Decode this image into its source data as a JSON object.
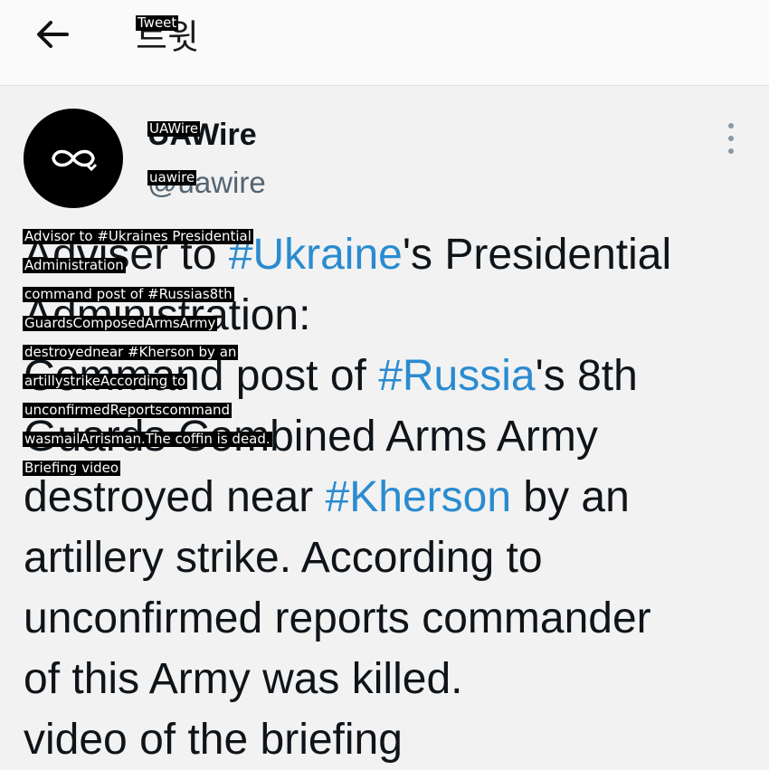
{
  "header": {
    "title": "트윗",
    "title_overlay": "Tweet"
  },
  "tweet": {
    "display_name": "UAWire",
    "display_name_overlay": "UAWire",
    "handle": "@uawire",
    "handle_overlay": "uawire",
    "avatar_icon": "infinity-logo-icon",
    "body": {
      "l1_pre": "Adviser to ",
      "l1_tag": "#Ukraine",
      "l1_post": "'s Presidential",
      "l2": "Administration:",
      "l3_pre": "Command post of ",
      "l3_tag": "#Russia",
      "l3_post": "'s 8th",
      "l4": "Guards Combined Arms Army",
      "l5_pre": "destroyed near ",
      "l5_tag": "#Kherson",
      "l5_post": " by an",
      "l6": "artillery strike. According to",
      "l7": "unconfirmed reports commander",
      "l8": "of this Army was killed.",
      "l9": "video of the briefing"
    },
    "overlay_lines": [
      "Advisor to #Ukraines Presidential",
      "Administration",
      "command post of #Russias8th",
      "GuardsComposedArmsArmy",
      "destroyednear #Kherson by an",
      "artillystrikeAccording to",
      "unconfirmedReportscommand",
      "wasmailArrisman.The coffin is dead.",
      "Briefing video"
    ]
  }
}
